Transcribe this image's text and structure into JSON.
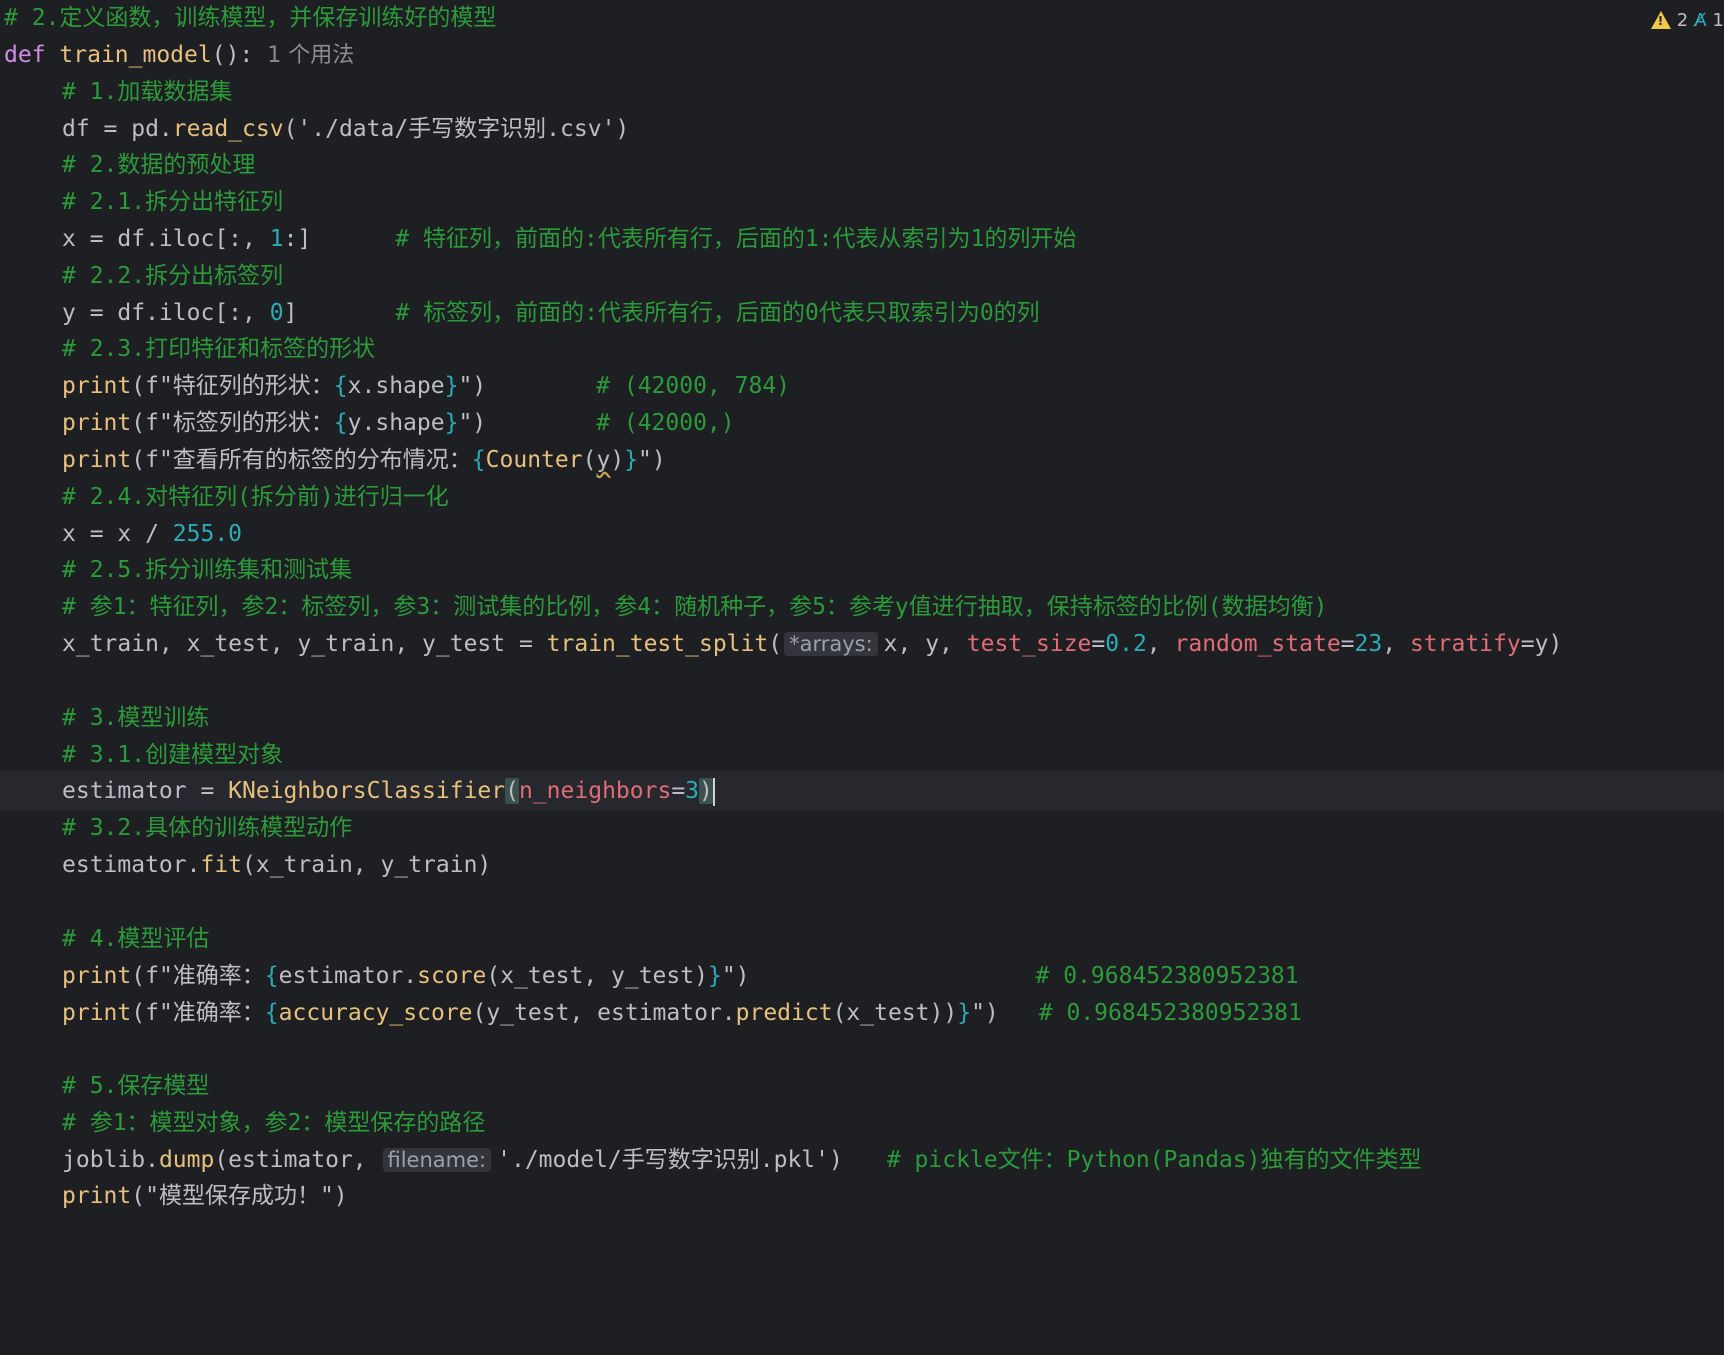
{
  "status": {
    "warnings_count": "2",
    "typos_count": "1"
  },
  "code": {
    "l1": "# 2.定义函数，训练模型，并保存训练好的模型",
    "l2_kw": "def",
    "l2_fn": "train_model",
    "l2_rest": "():",
    "l2_usage": "1 个用法",
    "l3": "# 1.加载数据集",
    "l4_a": "df = pd.",
    "l4_fn": "read_csv",
    "l4_b": "('./data/手写数字识别.csv')",
    "l5": "# 2.数据的预处理",
    "l6": "# 2.1.拆分出特征列",
    "l7_a": "x = df.iloc[:, ",
    "l7_num": "1",
    "l7_b": ":]",
    "l7_cmt": "# 特征列，前面的:代表所有行，后面的1:代表从索引为1的列开始",
    "l8": "# 2.2.拆分出标签列",
    "l9_a": "y = df.iloc[:, ",
    "l9_num": "0",
    "l9_b": "]",
    "l9_cmt": "# 标签列，前面的:代表所有行，后面的0代表只取索引为0的列",
    "l10": "# 2.3.打印特征和标签的形状",
    "l11_fn": "print",
    "l11_a": "(f\"特征列的形状：",
    "l11_expr": "x.shape",
    "l11_b": "\")",
    "l11_cmt": "# (42000, 784)",
    "l12_fn": "print",
    "l12_a": "(f\"标签列的形状：",
    "l12_expr": "y.shape",
    "l12_b": "\")",
    "l12_cmt": "# (42000,)",
    "l13_fn": "print",
    "l13_a": "(f\"查看所有的标签的分布情况：",
    "l13_cls": "Counter",
    "l13_arg": "y",
    "l13_b": "\")",
    "l14": "# 2.4.对特征列(拆分前)进行归一化",
    "l15_a": "x = x / ",
    "l15_num": "255.0",
    "l16": "# 2.5.拆分训练集和测试集",
    "l17": "# 参1：特征列，参2：标签列，参3：测试集的比例，参4：随机种子，参5：参考y值进行抽取，保持标签的比例(数据均衡)",
    "l18_a": "x_train, x_test, y_train, y_test = ",
    "l18_fn": "train_test_split",
    "l18_hint": "*arrays:",
    "l18_b": "x, y, ",
    "l18_p1": "test_size",
    "l18_v1": "0.2",
    "l18_p2": "random_state",
    "l18_v2": "23",
    "l18_p3": "stratify",
    "l18_v3": "y",
    "l20": "# 3.模型训练",
    "l21": "# 3.1.创建模型对象",
    "l22_a": "estimator = ",
    "l22_cls": "KNeighborsClassifier",
    "l22_p": "n_neighbors",
    "l22_v": "3",
    "l23": "# 3.2.具体的训练模型动作",
    "l24_a": "estimator.",
    "l24_fn": "fit",
    "l24_b": "(x_train, y_train)",
    "l26": "# 4.模型评估",
    "l27_fn": "print",
    "l27_a": "(f\"准确率：",
    "l27_expr_a": "estimator.",
    "l27_expr_fn": "score",
    "l27_expr_b": "(x_test, y_test)",
    "l27_b": "\")",
    "l27_cmt": "# 0.968452380952381",
    "l28_fn": "print",
    "l28_a": "(f\"准确率：",
    "l28_expr_fn": "accuracy_score",
    "l28_expr_a": "(y_test, estimator.",
    "l28_expr_fn2": "predict",
    "l28_expr_b": "(x_test))",
    "l28_b": "\")",
    "l28_cmt": "# 0.968452380952381",
    "l30": "# 5.保存模型",
    "l31": "# 参1：模型对象，参2：模型保存的路径",
    "l32_a": "joblib.",
    "l32_fn": "dump",
    "l32_b": "(estimator, ",
    "l32_hint": "filename:",
    "l32_c": "'./model/手写数字识别.pkl')",
    "l32_cmt": "# pickle文件：Python(Pandas)独有的文件类型",
    "l33_fn": "print",
    "l33_a": "(\"模型保存成功！\")"
  }
}
